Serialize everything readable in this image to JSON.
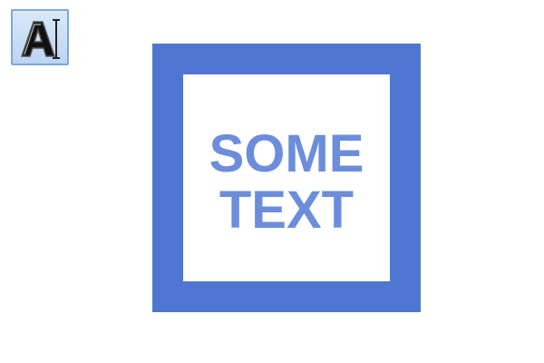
{
  "toolbar": {
    "text_tool": {
      "icon": "text-tool-icon",
      "glyph": "A"
    }
  },
  "canvas": {
    "text_lines": [
      "SOME",
      "TEXT"
    ],
    "colors": {
      "frame": "#4f77d1",
      "text": "#6b8ddb",
      "background": "#ffffff"
    }
  }
}
